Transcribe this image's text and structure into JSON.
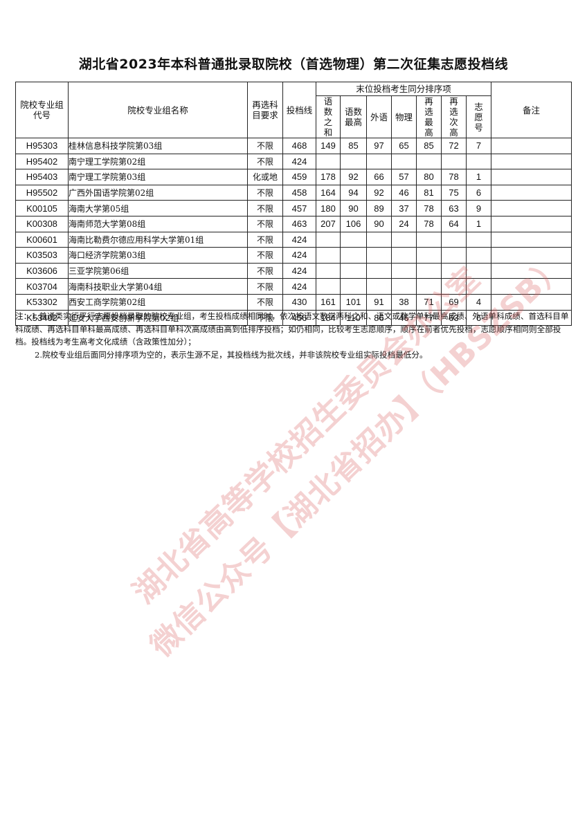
{
  "title": "湖北省2023年本科普通批录取院校（首选物理）第二次征集志愿投档线",
  "headers": {
    "code": "院校专业组代号",
    "name": "院校专业组名称",
    "req": "再选科目要求",
    "score": "投档线",
    "rank_group": "末位投档考生同分排序项",
    "chn_math_sum": "语数之和",
    "chn_math_max": "语数最高",
    "foreign": "外语",
    "physics": "物理",
    "elective_max": "再选最高",
    "elective_second": "再选次高",
    "wish_no": "志愿号",
    "remark": "备注"
  },
  "rows": [
    {
      "code": "H95303",
      "name": "桂林信息科技学院第03组",
      "req": "不限",
      "score": "468",
      "s1": "149",
      "s2": "85",
      "s3": "97",
      "s4": "65",
      "s5": "85",
      "s6": "72",
      "s7": "7",
      "remark": ""
    },
    {
      "code": "H95402",
      "name": "南宁理工学院第02组",
      "req": "不限",
      "score": "424",
      "s1": "",
      "s2": "",
      "s3": "",
      "s4": "",
      "s5": "",
      "s6": "",
      "s7": "",
      "remark": ""
    },
    {
      "code": "H95403",
      "name": "南宁理工学院第03组",
      "req": "化或地",
      "score": "459",
      "s1": "178",
      "s2": "92",
      "s3": "66",
      "s4": "57",
      "s5": "80",
      "s6": "78",
      "s7": "1",
      "remark": ""
    },
    {
      "code": "H95502",
      "name": "广西外国语学院第02组",
      "req": "不限",
      "score": "458",
      "s1": "164",
      "s2": "94",
      "s3": "92",
      "s4": "46",
      "s5": "81",
      "s6": "75",
      "s7": "6",
      "remark": ""
    },
    {
      "code": "K00105",
      "name": "海南大学第05组",
      "req": "不限",
      "score": "457",
      "s1": "180",
      "s2": "90",
      "s3": "89",
      "s4": "37",
      "s5": "78",
      "s6": "63",
      "s7": "9",
      "remark": ""
    },
    {
      "code": "K00308",
      "name": "海南师范大学第08组",
      "req": "不限",
      "score": "463",
      "s1": "207",
      "s2": "106",
      "s3": "90",
      "s4": "24",
      "s5": "78",
      "s6": "64",
      "s7": "1",
      "remark": ""
    },
    {
      "code": "K00601",
      "name": "海南比勒费尔德应用科学大学第01组",
      "req": "不限",
      "score": "424",
      "s1": "",
      "s2": "",
      "s3": "",
      "s4": "",
      "s5": "",
      "s6": "",
      "s7": "",
      "remark": ""
    },
    {
      "code": "K03503",
      "name": "海口经济学院第03组",
      "req": "不限",
      "score": "424",
      "s1": "",
      "s2": "",
      "s3": "",
      "s4": "",
      "s5": "",
      "s6": "",
      "s7": "",
      "remark": ""
    },
    {
      "code": "K03606",
      "name": "三亚学院第06组",
      "req": "不限",
      "score": "424",
      "s1": "",
      "s2": "",
      "s3": "",
      "s4": "",
      "s5": "",
      "s6": "",
      "s7": "",
      "remark": ""
    },
    {
      "code": "K03704",
      "name": "海南科技职业大学第04组",
      "req": "不限",
      "score": "424",
      "s1": "",
      "s2": "",
      "s3": "",
      "s4": "",
      "s5": "",
      "s6": "",
      "s7": "",
      "remark": ""
    },
    {
      "code": "K53302",
      "name": "西安工商学院第02组",
      "req": "不限",
      "score": "430",
      "s1": "161",
      "s2": "101",
      "s3": "91",
      "s4": "38",
      "s5": "71",
      "s6": "69",
      "s7": "4",
      "remark": ""
    },
    {
      "code": "K53402",
      "name": "延安大学西安创新学院第02组",
      "req": "不限",
      "score": "456",
      "s1": "184",
      "s2": "110",
      "s3": "86",
      "s4": "46",
      "s5": "77",
      "s6": "63",
      "s7": "6",
      "remark": ""
    }
  ],
  "notes": {
    "note1": "注：1.普通类实行平行志愿投档录取的院校专业组，考生投档成绩相同时，依次按语文数学两科之和、语文或数学单科最高成绩、外语单科成绩、首选科目单科成绩、再选科目单科最高成绩、再选科目单科次高成绩由高到低排序投档；如仍相同，比较考生志愿顺序，顺序在前者优先投档，志愿顺序相同则全部投档。投档线为考生高考文化成绩（含政策性加分）；",
    "note2": "2.院校专业组后面同分排序项为空的，表示生源不足，其投档线为批次线，并非该院校专业组实际投档最低分。"
  },
  "watermark": {
    "line1": "湖北省高等学校招生委员会办公室",
    "line2": "微信公众号【湖北省招办】（HBSZSB）",
    "color": "#d75a5a"
  }
}
